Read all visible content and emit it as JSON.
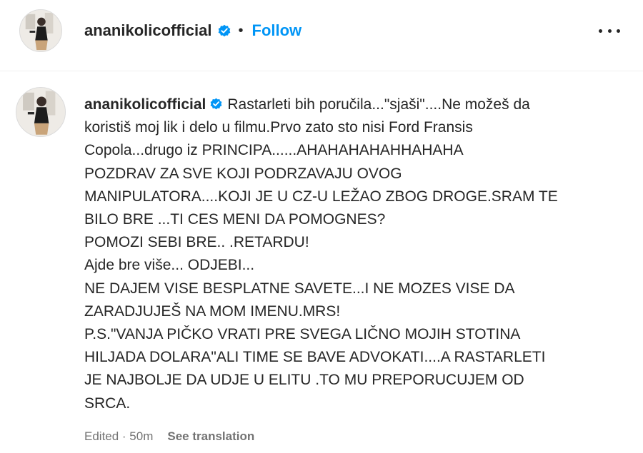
{
  "header": {
    "username": "ananikolicofficial",
    "separator": "•",
    "follow_label": "Follow",
    "avatar_icon": "profile-photo",
    "verified_icon": "verified-badge-icon",
    "more_icon": "more-options-icon"
  },
  "comment": {
    "username": "ananikolicofficial",
    "lines": [
      "Rastarleti bih poručila...\"sjaši\"....Ne možeš da",
      "koristiš moj lik i delo u filmu.Prvo zato sto nisi Ford Fransis",
      "Copola...drugo iz PRINCIPA......AHAHAHAHAHHAHAHA",
      "POZDRAV ZA SVE KOJI PODRZAVAJU OVOG",
      "MANIPULATORA....KOJI JE U CZ-U LEŽAO ZBOG DROGE.SRAM TE",
      "BILO BRE ...TI CES MENI DA POMOGNES?",
      "POMOZI SEBI BRE.. .RETARDU!",
      "Ajde bre više... ODJEBI...",
      "NE DAJEM VISE BESPLATNE SAVETE...I NE MOZES VISE DA",
      "ZARADJUJEŠ NA MOM IMENU.MRS!",
      "P.S.\"VANJA PIČKO VRATI PRE SVEGA LIČNO MOJIH STOTINA",
      "HILJADA DOLARA\"ALI TIME SE BAVE ADVOKATI....A RASTARLETI",
      "JE NAJBOLJE DA UDJE U ELITU .TO MU PREPORUCUJEM OD",
      "SRCA."
    ]
  },
  "meta": {
    "edited": "Edited · 50m",
    "translate_label": "See translation"
  },
  "colors": {
    "link": "#0095f6",
    "verified": "#0095f6",
    "text": "#262626",
    "secondary": "#737373"
  }
}
